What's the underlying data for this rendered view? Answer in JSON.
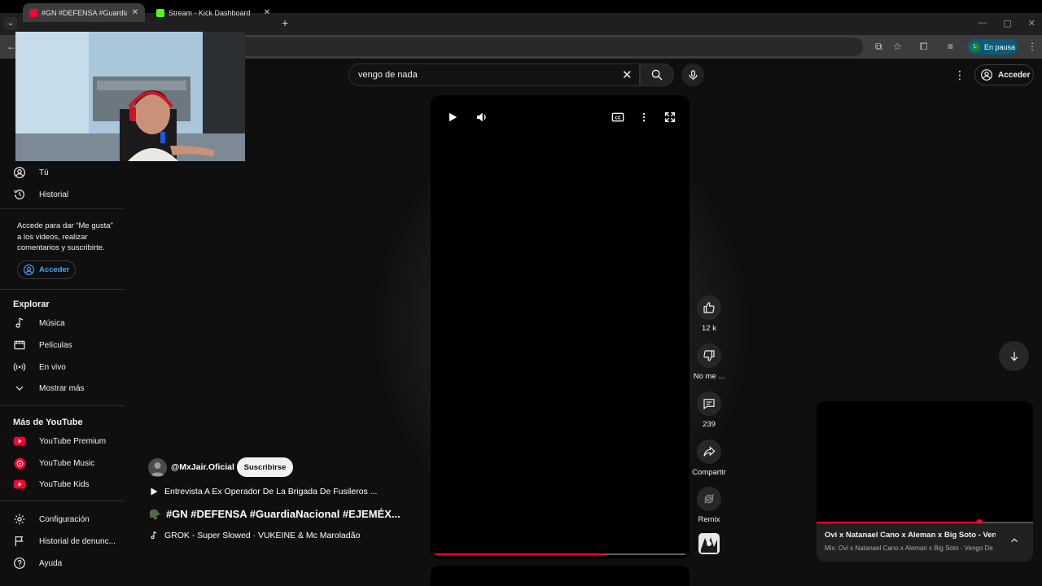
{
  "browser": {
    "tabs": [
      {
        "title": "#GN #DEFENSA #GuardiaNacional",
        "active": true,
        "favicon_color": "#ff0033"
      },
      {
        "title": "Stream - Kick Dashboard",
        "active": false,
        "favicon_color": "#53fc18"
      }
    ],
    "profile": {
      "initial": "L",
      "label": "En pausa"
    }
  },
  "header": {
    "search_value": "vengo de nada",
    "signin_label": "Acceder"
  },
  "sidebar": {
    "you_items": [
      {
        "label": "Tú",
        "icon": "user-circle-icon"
      },
      {
        "label": "Historial",
        "icon": "history-icon"
      }
    ],
    "signin_prompt": "Accede para dar “Me gusta” a los videos, realizar comentarios y suscribirte.",
    "signin_label": "Acceder",
    "explore_title": "Explorar",
    "explore_items": [
      {
        "label": "Música",
        "icon": "music-note-icon"
      },
      {
        "label": "Películas",
        "icon": "film-icon"
      },
      {
        "label": "En vivo",
        "icon": "live-icon"
      },
      {
        "label": "Mostrar más",
        "icon": "chevron-down-icon"
      }
    ],
    "more_title": "Más de YouTube",
    "more_items": [
      {
        "label": "YouTube Premium",
        "icon": "youtube-premium-icon"
      },
      {
        "label": "YouTube Music",
        "icon": "youtube-music-icon"
      },
      {
        "label": "YouTube Kids",
        "icon": "youtube-kids-icon"
      }
    ],
    "bottom_items": [
      {
        "label": "Configuración",
        "icon": "gear-icon"
      },
      {
        "label": "Historial de denunc...",
        "icon": "flag-icon"
      },
      {
        "label": "Ayuda",
        "icon": "help-icon"
      }
    ]
  },
  "short": {
    "channel": "@MxJair.Oficial",
    "subscribe_label": "Suscribirse",
    "related_title": "Entrevista A Ex Operador De La Brigada De Fusileros ...",
    "title": "#GN #DEFENSA #GuardiaNacional #EJEMÉX...",
    "title_emoji": "🪖",
    "sound": "GROK - Super Slowed · VUKEINE & Mc Maroladão",
    "progress": 0.68
  },
  "actions": {
    "likes": "12 k",
    "dislike": "No me ...",
    "comments": "239",
    "share": "Compartir",
    "remix": "Remix"
  },
  "miniplayer": {
    "title": "Ovi x Natanael Cano x Aleman x Big Soto - Veng...",
    "subtitle": "Mix: Ovi x Natanael Cano x Aleman x Big Soto - Vengo De ...",
    "progress": 0.75
  }
}
